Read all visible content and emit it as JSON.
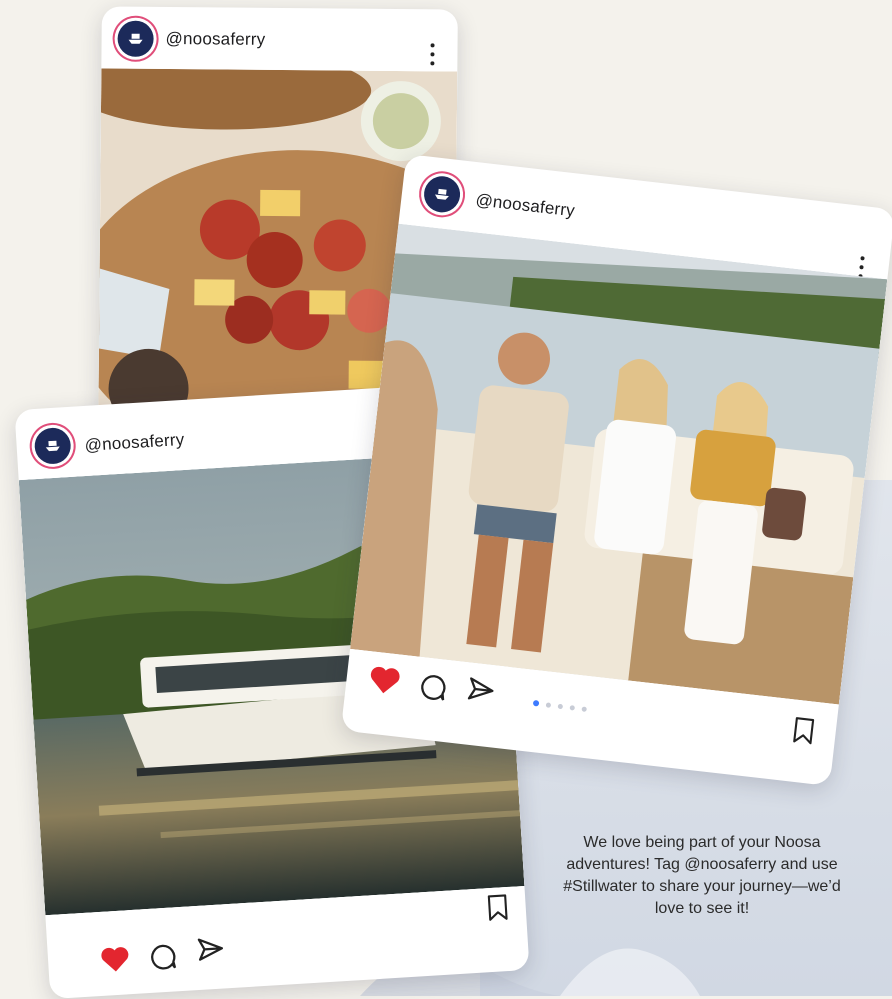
{
  "posts": [
    {
      "handle": "@noosaferry",
      "image": "charcuterie-board-photo"
    },
    {
      "handle": "@noosaferry",
      "image": "stillwater-ferry-photo"
    },
    {
      "handle": "@noosaferry",
      "image": "friends-on-boat-photo",
      "liked": true
    }
  ],
  "caption": "We love being part of your Noosa adventures! Tag @noosaferry and use #Stillwater to share your journey—we’d love to see it!",
  "colors": {
    "like": "#e3262f",
    "accent_dot": "#3d7bff",
    "avatar_bg": "#1c2a5a",
    "background": "#f4f2ec"
  },
  "icons": [
    "boat-logo-icon",
    "more-options-icon",
    "heart-icon",
    "comment-icon",
    "send-icon",
    "bookmark-icon"
  ]
}
